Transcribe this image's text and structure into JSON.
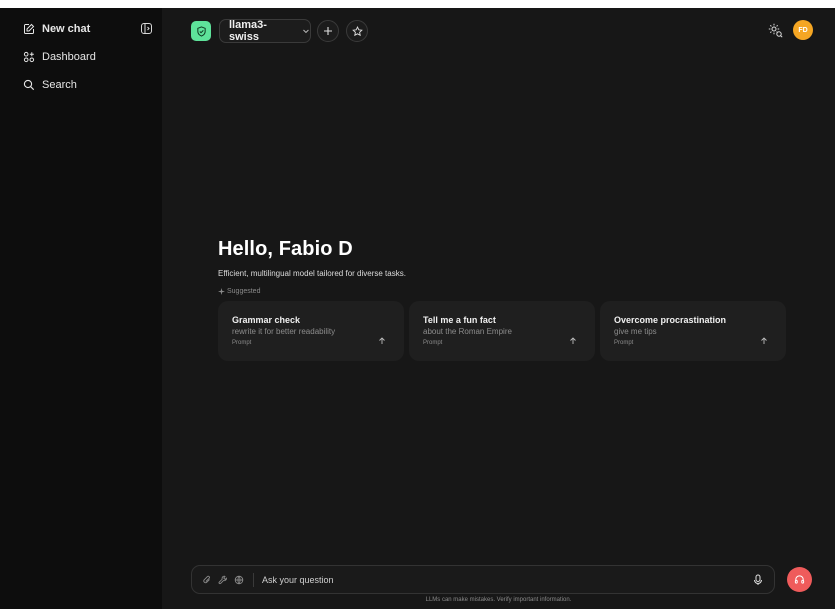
{
  "sidebar": {
    "items": [
      {
        "label": "New chat",
        "icon": "compose-icon"
      },
      {
        "label": "Dashboard",
        "icon": "dashboard-icon"
      },
      {
        "label": "Search",
        "icon": "search-icon"
      }
    ]
  },
  "topbar": {
    "model": "llama3-swiss",
    "avatar_initials": "FD"
  },
  "hero": {
    "greeting": "Hello, Fabio D",
    "subtitle": "Efficient, multilingual model tailored for diverse tasks.",
    "suggested_label": "Suggested"
  },
  "cards": [
    {
      "title": "Grammar check",
      "subtitle": "rewrite it for better readability",
      "tag": "Prompt"
    },
    {
      "title": "Tell me a fun fact",
      "subtitle": "about the Roman Empire",
      "tag": "Prompt"
    },
    {
      "title": "Overcome procrastination",
      "subtitle": "give me tips",
      "tag": "Prompt"
    }
  ],
  "composer": {
    "placeholder": "Ask your question"
  },
  "disclaimer": "LLMs can make mistakes. Verify important information.",
  "colors": {
    "sidebar_bg": "#0d0d0d",
    "main_bg": "#171717",
    "accent_green": "#5ee29a",
    "avatar_orange": "#f5a623",
    "call_red": "#ef5b5b"
  }
}
